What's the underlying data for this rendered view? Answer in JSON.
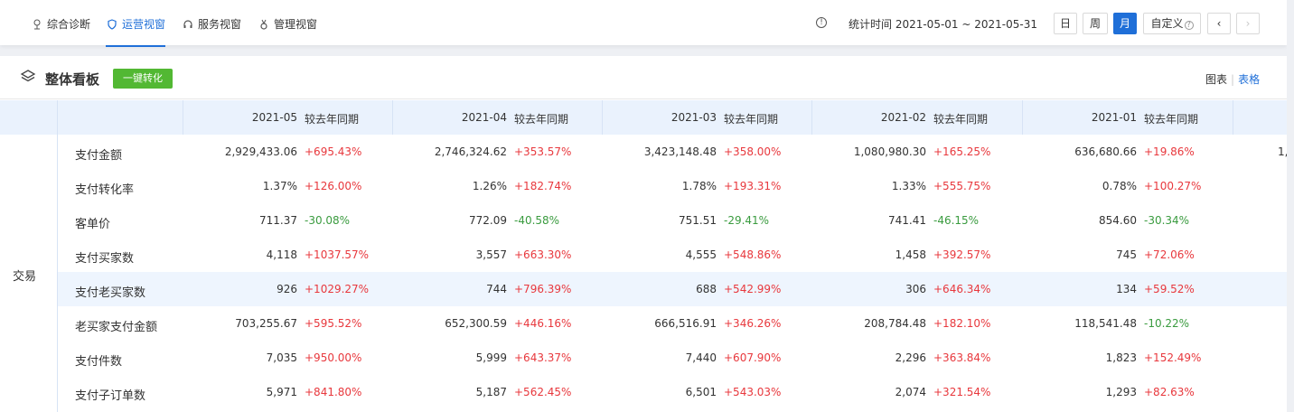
{
  "nav": {
    "tabs": [
      {
        "label": "综合诊断",
        "icon": "diagnosis-icon",
        "active": false
      },
      {
        "label": "运营视窗",
        "icon": "shield-icon",
        "active": true
      },
      {
        "label": "服务视窗",
        "icon": "headset-icon",
        "active": false
      },
      {
        "label": "管理视窗",
        "icon": "medal-icon",
        "active": false
      }
    ],
    "date_range": "统计时间 2021-05-01 ~ 2021-05-31",
    "period_buttons": [
      "日",
      "周",
      "月",
      "自定义"
    ],
    "active_period": "月",
    "prev_icon": "chevron-left-icon",
    "next_icon": "chevron-right-icon"
  },
  "panel": {
    "title": "整体看板",
    "convert_button": "一键转化",
    "view_chart": "图表",
    "view_separator": "|",
    "view_table": "表格"
  },
  "table": {
    "compare_header": "较去年同期",
    "months": [
      "2021-05",
      "2021-04",
      "2021-03",
      "2021-02",
      "2021-01"
    ],
    "group": "交易",
    "clipped_partial_value": "1,",
    "rows": [
      {
        "label": "支付金额",
        "cells": [
          [
            "2,929,433.06",
            "+695.43%"
          ],
          [
            "2,746,324.62",
            "+353.57%"
          ],
          [
            "3,423,148.48",
            "+358.00%"
          ],
          [
            "1,080,980.30",
            "+165.25%"
          ],
          [
            "636,680.66",
            "+19.86%"
          ]
        ]
      },
      {
        "label": "支付转化率",
        "cells": [
          [
            "1.37%",
            "+126.00%"
          ],
          [
            "1.26%",
            "+182.74%"
          ],
          [
            "1.78%",
            "+193.31%"
          ],
          [
            "1.33%",
            "+555.75%"
          ],
          [
            "0.78%",
            "+100.27%"
          ]
        ]
      },
      {
        "label": "客单价",
        "cells": [
          [
            "711.37",
            "-30.08%"
          ],
          [
            "772.09",
            "-40.58%"
          ],
          [
            "751.51",
            "-29.41%"
          ],
          [
            "741.41",
            "-46.15%"
          ],
          [
            "854.60",
            "-30.34%"
          ]
        ]
      },
      {
        "label": "支付买家数",
        "cells": [
          [
            "4,118",
            "+1037.57%"
          ],
          [
            "3,557",
            "+663.30%"
          ],
          [
            "4,555",
            "+548.86%"
          ],
          [
            "1,458",
            "+392.57%"
          ],
          [
            "745",
            "+72.06%"
          ]
        ]
      },
      {
        "label": "支付老买家数",
        "cells": [
          [
            "926",
            "+1029.27%"
          ],
          [
            "744",
            "+796.39%"
          ],
          [
            "688",
            "+542.99%"
          ],
          [
            "306",
            "+646.34%"
          ],
          [
            "134",
            "+59.52%"
          ]
        ]
      },
      {
        "label": "老买家支付金额",
        "cells": [
          [
            "703,255.67",
            "+595.52%"
          ],
          [
            "652,300.59",
            "+446.16%"
          ],
          [
            "666,516.91",
            "+346.26%"
          ],
          [
            "208,784.48",
            "+182.10%"
          ],
          [
            "118,541.48",
            "-10.22%"
          ]
        ]
      },
      {
        "label": "支付件数",
        "cells": [
          [
            "7,035",
            "+950.00%"
          ],
          [
            "5,999",
            "+643.37%"
          ],
          [
            "7,440",
            "+607.90%"
          ],
          [
            "2,296",
            "+363.84%"
          ],
          [
            "1,823",
            "+152.49%"
          ]
        ]
      },
      {
        "label": "支付子订单数",
        "cells": [
          [
            "5,971",
            "+841.80%"
          ],
          [
            "5,187",
            "+562.45%"
          ],
          [
            "6,501",
            "+543.03%"
          ],
          [
            "2,074",
            "+321.54%"
          ],
          [
            "1,293",
            "+82.63%"
          ]
        ]
      }
    ],
    "highlighted_row": "支付老买家数"
  }
}
